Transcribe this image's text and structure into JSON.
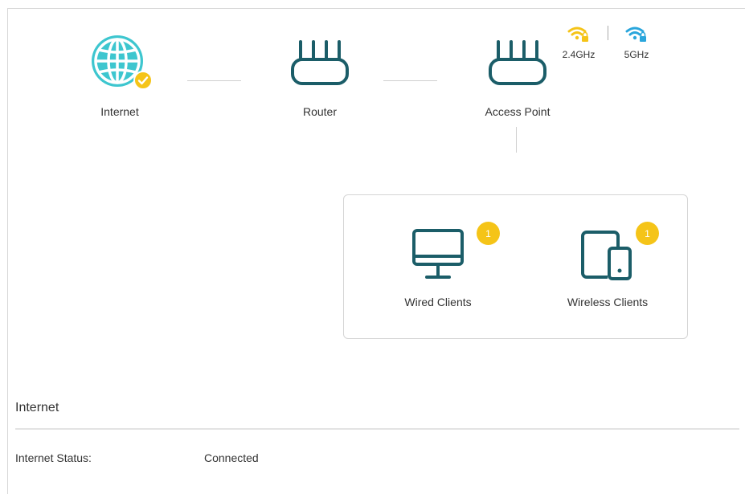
{
  "topology": {
    "internet_label": "Internet",
    "router_label": "Router",
    "access_point_label": "Access Point",
    "internet_status_icon": "check-badge-icon"
  },
  "bands": {
    "band_24_label": "2.4GHz",
    "band_5_label": "5GHz",
    "band_24_color": "#f5c418",
    "band_5_color": "#2aa6dc"
  },
  "clients": {
    "wired_label": "Wired Clients",
    "wired_count": "1",
    "wireless_label": "Wireless Clients",
    "wireless_count": "1"
  },
  "internet_section": {
    "title": "Internet",
    "status_key": "Internet Status:",
    "status_value": "Connected"
  },
  "colors": {
    "device_teal": "#1b5d68",
    "globe_teal": "#3dc6cf",
    "badge_yellow": "#f5c418"
  }
}
